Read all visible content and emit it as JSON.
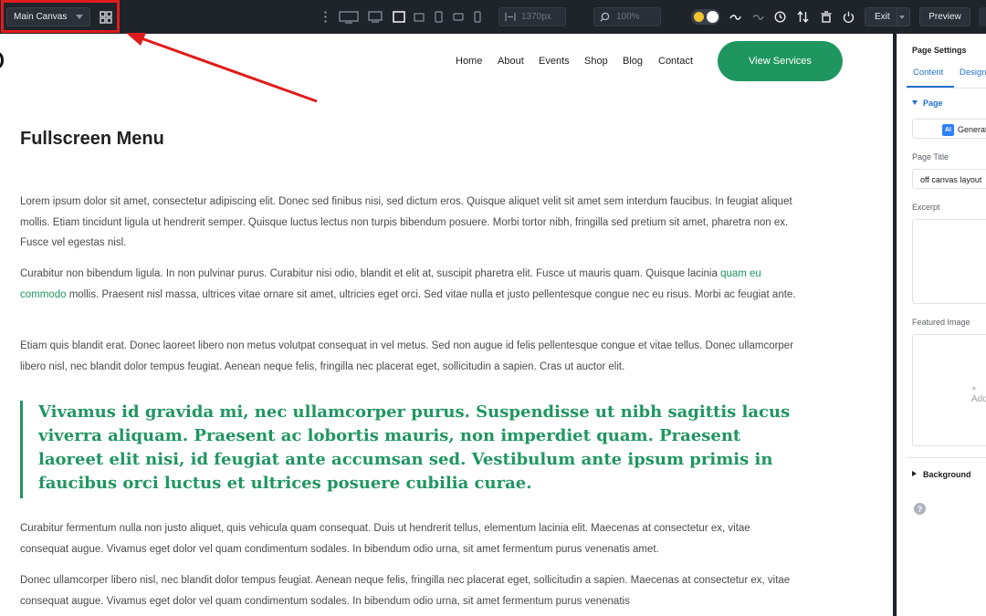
{
  "toolbar": {
    "canvas_select": "Main Canvas",
    "width_value": "1370px",
    "zoom_value": "100%",
    "exit_label": "Exit",
    "preview_label": "Preview"
  },
  "nav": {
    "items": [
      "Home",
      "About",
      "Events",
      "Shop",
      "Blog",
      "Contact"
    ],
    "cta_label": "View Services"
  },
  "content": {
    "heading": "Fullscreen Menu",
    "para1": "Lorem ipsum dolor sit amet, consectetur adipiscing elit. Donec sed finibus nisi, sed dictum eros. Quisque aliquet velit sit amet sem interdum faucibus. In feugiat aliquet mollis. Etiam tincidunt ligula ut hendrerit semper. Quisque luctus lectus non turpis bibendum posuere. Morbi tortor nibh, fringilla sed pretium sit amet, pharetra non ex. Fusce vel egestas nisl.",
    "para2_before": "Curabitur non bibendum ligula. In non pulvinar purus. Curabitur nisi odio, blandit et elit at, suscipit pharetra elit. Fusce ut mauris quam. Quisque lacinia ",
    "para2_link": "quam eu commodo",
    "para2_after": " mollis. Praesent nisl massa, ultrices vitae ornare sit amet, ultricies eget orci. Sed vitae nulla et justo pellentesque congue nec eu risus. Morbi ac feugiat ante.",
    "para3": "Etiam quis blandit erat. Donec laoreet libero non metus volutpat consequat in vel metus. Sed non augue id felis pellentesque congue et vitae tellus. Donec ullamcorper libero nisl, nec blandit dolor tempus feugiat. Aenean neque felis, fringilla nec placerat eget, sollicitudin a sapien. Cras ut auctor elit.",
    "quote": "Vivamus id gravida mi, nec ullamcorper purus. Suspendisse ut nibh sagittis lacus viverra aliquam. Praesent ac lobortis mauris, non imperdiet quam. Praesent laoreet elit nisi, id feugiat ante accumsan sed. Vestibulum ante ipsum primis in faucibus orci luctus et ultrices posuere cubilia curae.",
    "para4": "Curabitur fermentum nulla non justo aliquet, quis vehicula quam consequat. Duis ut hendrerit tellus, elementum lacinia elit. Maecenas at consectetur ex, vitae consequat augue. Vivamus eget dolor vel quam condimentum sodales. In bibendum odio urna, sit amet fermentum purus venenatis amet.",
    "para5": "Donec ullamcorper libero nisl, nec blandit dolor tempus feugiat. Aenean neque felis, fringilla nec placerat eget, sollicitudin a sapien. Maecenas at consectetur ex, vitae consequat augue. Vivamus eget dolor vel quam condimentum sodales. In bibendum odio urna, sit amet fermentum purus venenatis"
  },
  "sidebar": {
    "title": "Page Settings",
    "tab_content": "Content",
    "tab_design": "Design",
    "section_page": "Page",
    "ai_button": "Generate",
    "page_title_label": "Page Title",
    "page_title_value": "off canvas layout",
    "excerpt_label": "Excerpt",
    "featured_image_label": "Featured Image",
    "add_image": "+ Add",
    "section_background": "Background",
    "help": "?"
  },
  "colors": {
    "toolbar_bg": "#1f232a",
    "accent_green": "#1f9660",
    "link_blue": "#2271d1",
    "highlight_red": "#e01b1b"
  },
  "icons": [
    "grid-icon",
    "more-vertical-icon",
    "desktop-icon",
    "laptop-icon",
    "tablet-landscape-icon",
    "tablet-portrait-icon",
    "phone-landscape-icon",
    "phone-portrait-icon",
    "width-icon",
    "zoom-icon",
    "undo-icon",
    "redo-icon",
    "history-icon",
    "sort-icon",
    "trash-icon",
    "power-icon",
    "help-icon"
  ]
}
